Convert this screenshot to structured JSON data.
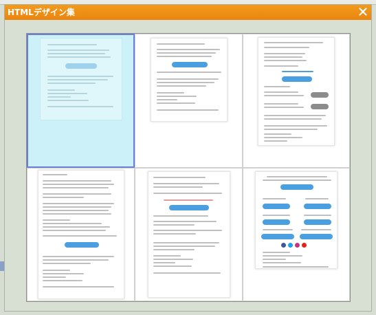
{
  "modal": {
    "title": "HTMLデザイン集",
    "close_icon": "close-icon"
  },
  "colors": {
    "header": "#f08e17",
    "selected_fill": "#cdf1f9",
    "selected_border": "#6a7fd6",
    "button_blue": "#4a9fe0"
  },
  "templates": [
    {
      "name": "template-1",
      "selected": true
    },
    {
      "name": "template-2",
      "selected": false
    },
    {
      "name": "template-3",
      "selected": false
    },
    {
      "name": "template-4",
      "selected": false
    },
    {
      "name": "template-5",
      "selected": false
    },
    {
      "name": "template-6",
      "selected": false
    }
  ]
}
